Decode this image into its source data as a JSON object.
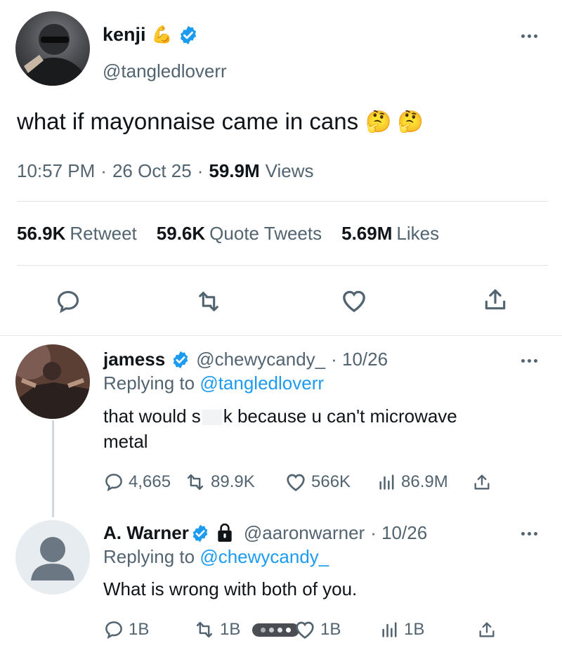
{
  "tweet": {
    "name": "kenji",
    "name_emoji": "💪",
    "handle": "@tangledloverr",
    "text": "what if mayonnaise came in cans",
    "text_emoji": "🤔 🤔",
    "time": "10:57 PM",
    "date": "26 Oct 25",
    "views_count": "59.9M",
    "views_label": "Views",
    "retweets_count": "56.9K",
    "retweets_label": "Retweet",
    "quotes_count": "59.6K",
    "quotes_label": "Quote Tweets",
    "likes_count": "5.69M",
    "likes_label": "Likes"
  },
  "replies": [
    {
      "name": "jamess",
      "handle": "@chewycandy_",
      "date": "· 10/26",
      "replying_prefix": "Replying to",
      "replying_to": "@tangledloverr",
      "text_part1": "that would s",
      "text_part2": "k because u can't microwave",
      "text_line2": "metal",
      "replies": "4,665",
      "retweets": "89.9K",
      "likes": "566K",
      "views": "86.9M"
    },
    {
      "name": "A. Warner",
      "handle": "@aaronwarner",
      "date": "· 10/26",
      "replying_prefix": "Replying to",
      "replying_to": "@chewycandy_",
      "text": "What is wrong with both of you.",
      "replies": "1B",
      "retweets": "1B",
      "likes": "1B",
      "views": "1B"
    }
  ],
  "colors": {
    "accent": "#1d9bf0",
    "secondary_text": "#536471",
    "primary_text": "#0f1419"
  }
}
